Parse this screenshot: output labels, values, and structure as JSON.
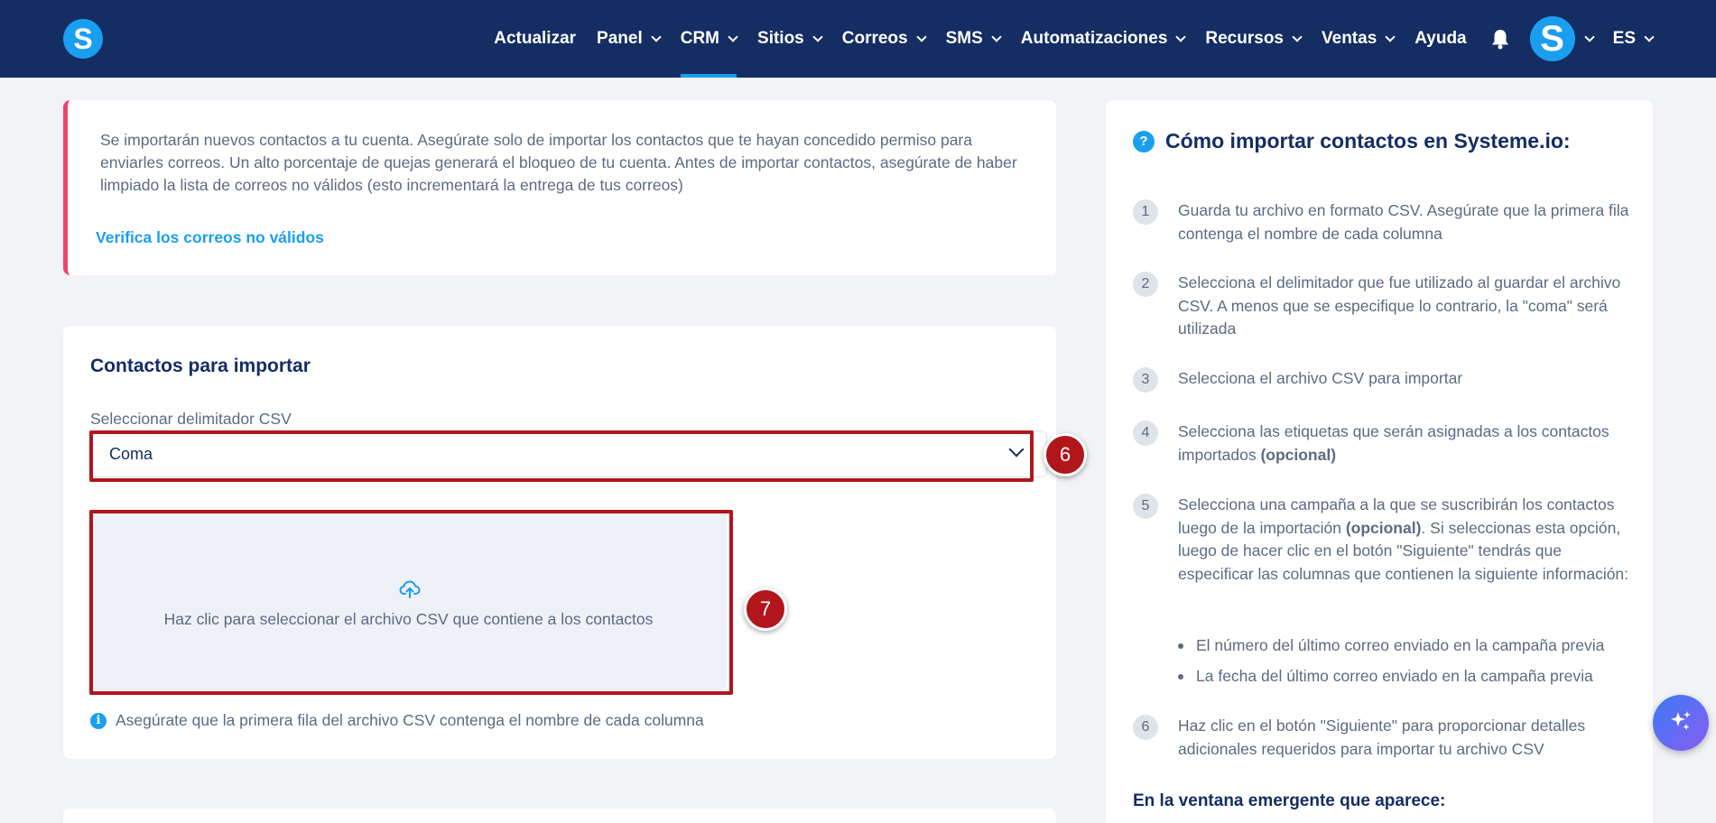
{
  "nav": {
    "logo": "S",
    "items": [
      {
        "label": "Actualizar",
        "dropdown": false
      },
      {
        "label": "Panel",
        "dropdown": true
      },
      {
        "label": "CRM",
        "dropdown": true,
        "active": true
      },
      {
        "label": "Sitios",
        "dropdown": true
      },
      {
        "label": "Correos",
        "dropdown": true
      },
      {
        "label": "SMS",
        "dropdown": true
      },
      {
        "label": "Automatizaciones",
        "dropdown": true
      },
      {
        "label": "Recursos",
        "dropdown": true
      },
      {
        "label": "Ventas",
        "dropdown": true
      },
      {
        "label": "Ayuda",
        "dropdown": false
      }
    ],
    "avatar": "S",
    "language": "ES"
  },
  "warning": {
    "text": "Se importarán nuevos contactos a tu cuenta. Asegúrate solo de importar los contactos que te hayan concedido permiso para enviarles correos. Un alto porcentaje de quejas generará el bloqueo de tu cuenta. Antes de importar contactos, asegúrate de haber limpiado la lista de correos no válidos (esto incrementará la entrega de tus correos)",
    "link": "Verifica los correos no válidos"
  },
  "import": {
    "title": "Contactos para importar",
    "delimiter_label": "Seleccionar delimitador CSV",
    "delimiter_value": "Coma",
    "dropzone_text": "Haz clic para seleccionar el archivo CSV que contiene a los contactos",
    "hint": "Asegúrate que la primera fila del archivo CSV contenga el nombre de cada columna"
  },
  "annotations": {
    "badge_6": "6",
    "badge_7": "7"
  },
  "help": {
    "icon": "?",
    "title": "Cómo importar contactos en Systeme.io:",
    "steps": [
      {
        "num": "1",
        "text": "Guarda tu archivo en formato CSV. Asegúrate que la primera fila contenga el nombre de cada columna"
      },
      {
        "num": "2",
        "text": "Selecciona el delimitador que fue utilizado al guardar el archivo CSV. A menos que se especifique lo contrario, la \"coma\" será utilizada"
      },
      {
        "num": "3",
        "text": "Selecciona el archivo CSV para importar"
      },
      {
        "num": "4",
        "text_before": "Selecciona las etiquetas que serán asignadas a los contactos importados ",
        "bold": "(opcional)"
      },
      {
        "num": "5",
        "text_before": "Selecciona una campaña a la que se suscribirán los contactos luego de la importación ",
        "bold": "(opcional)",
        "text_after": ". Si seleccionas esta opción, luego de hacer clic en el botón \"Siguiente\" tendrás que especificar las columnas que contienen la siguiente información:"
      },
      {
        "num": "6",
        "text": "Haz clic en el botón \"Siguiente\" para proporcionar detalles adicionales requeridos para importar tu archivo CSV"
      }
    ],
    "bullets": [
      "El número del último correo enviado en la campaña previa",
      "La fecha del último correo enviado en la campaña previa"
    ],
    "subtitle": "En la ventana emergente que aparece:"
  },
  "colors": {
    "navbar": "#142d63",
    "accent": "#1a9ff0",
    "warning_border": "#f0426a",
    "highlight": "#b1161c"
  }
}
